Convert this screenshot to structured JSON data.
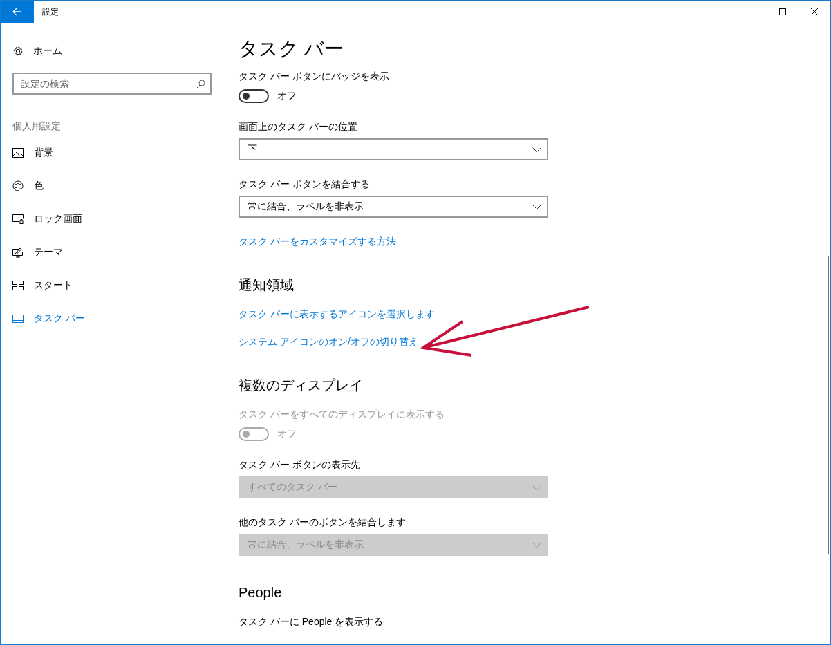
{
  "window": {
    "title": "設定"
  },
  "sidebar": {
    "home": "ホーム",
    "search": {
      "placeholder": "設定の検索"
    },
    "section": "個人用設定",
    "items": [
      {
        "kind": "picture",
        "label": "背景",
        "selected": false
      },
      {
        "kind": "palette",
        "label": "色",
        "selected": false
      },
      {
        "kind": "lockscreen",
        "label": "ロック画面",
        "selected": false
      },
      {
        "kind": "theme",
        "label": "テーマ",
        "selected": false
      },
      {
        "kind": "start",
        "label": "スタート",
        "selected": false
      },
      {
        "kind": "taskbar",
        "label": "タスク バー",
        "selected": true
      }
    ]
  },
  "page": {
    "title": "タスク バー",
    "items": [
      {
        "kind": "toggle",
        "label": "タスク バー ボタンにバッジを表示",
        "on": false,
        "state_text": "オフ",
        "disabled": false
      },
      {
        "kind": "dropdown",
        "label": "画面上のタスク バーの位置",
        "value": "下",
        "disabled": false
      },
      {
        "kind": "dropdown",
        "label": "タスク バー ボタンを結合する",
        "value": "常に結合、ラベルを非表示",
        "disabled": false
      },
      {
        "kind": "link",
        "text": "タスク バーをカスタマイズする方法"
      },
      {
        "kind": "heading",
        "text": "通知領域"
      },
      {
        "kind": "link",
        "text": "タスク バーに表示するアイコンを選択します"
      },
      {
        "kind": "link",
        "text": "システム アイコンのオン/オフの切り替え"
      },
      {
        "kind": "heading",
        "text": "複数のディスプレイ"
      },
      {
        "kind": "toggle",
        "label": "タスク バーをすべてのディスプレイに表示する",
        "on": false,
        "state_text": "オフ",
        "disabled": true
      },
      {
        "kind": "dropdown",
        "label": "タスク バー ボタンの表示先",
        "value": "すべてのタスク バー",
        "disabled": true
      },
      {
        "kind": "dropdown",
        "label": "他のタスク バーのボタンを結合します",
        "value": "常に結合、ラベルを非表示",
        "disabled": true
      },
      {
        "kind": "heading",
        "text": "People"
      },
      {
        "kind": "label",
        "text": "タスク バーに People を表示する"
      }
    ]
  }
}
